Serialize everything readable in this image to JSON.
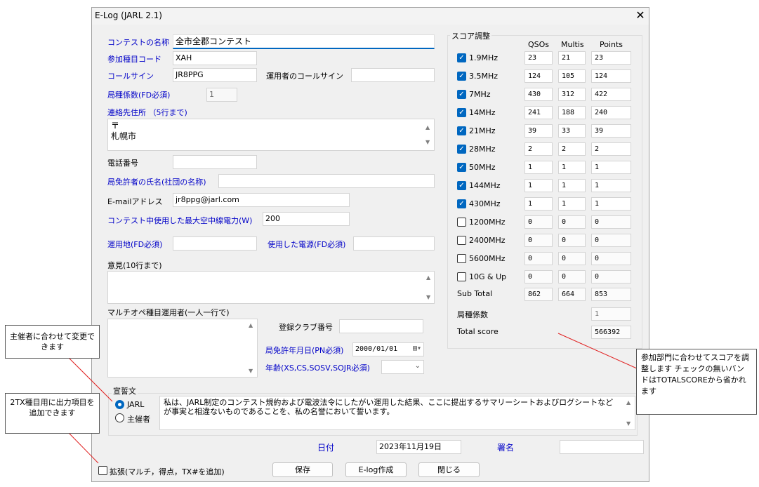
{
  "window": {
    "title": "E-Log (JARL 2.1)",
    "close_icon": "✕"
  },
  "form": {
    "contest_name_label": "コンテストの名称",
    "contest_name_value": "全市全郡コンテスト",
    "category_code_label": "参加種目コード",
    "category_code_value": "XAH",
    "callsign_label": "コールサイン",
    "callsign_value": "JR8PPG",
    "operator_callsign_label": "運用者のコールサイン",
    "operator_callsign_value": "",
    "station_factor_label": "局種係数(FD必須)",
    "station_factor_value": "1",
    "address_label": "連絡先住所 （5行まで)",
    "address_line1": "〒",
    "address_line2": "札幌市",
    "phone_label": "電話番号",
    "phone_value": "",
    "licensee_label": "局免許者の氏名(社団の名称)",
    "licensee_value": "",
    "email_label": "E-mailアドレス",
    "email_value": "jr8ppg@jarl.com",
    "power_label": "コンテスト中使用した最大空中線電力(W)",
    "power_value": "200",
    "location_label": "運用地(FD必須)",
    "location_value": "",
    "power_source_label": "使用した電源(FD必須)",
    "power_source_value": "",
    "comments_label": "意見(10行まで)",
    "comments_value": "",
    "multiop_label": "マルチオペ種目運用者(一人一行で)",
    "multiop_value": "",
    "club_no_label": "登録クラブ番号",
    "club_no_value": "",
    "license_date_label": "局免許年月日(PN必須)",
    "license_date_value": "2000/01/01",
    "age_label": "年齢(XS,CS,SOSV,SOJR必須)",
    "age_value": ""
  },
  "oath": {
    "group_title": "宣誓文",
    "radio_jarl": "JARL",
    "radio_organizer": "主催者",
    "selected": "JARL",
    "text": "私は、JARL制定のコンテスト規約および電波法令にしたがい運用した結果、ここに提出するサマリーシートおよびログシートなどが事実と相違ないものであることを、私の名誉において誓います。"
  },
  "footer": {
    "date_label": "日付",
    "date_value": "2023年11月19日",
    "signature_label": "署名",
    "signature_value": "",
    "extend_label": "拡張(マルチ，得点，TX#を追加)",
    "save_button": "保存",
    "elog_button": "E-log作成",
    "close_button": "閉じる"
  },
  "score": {
    "group_title": "スコア調整",
    "col_qsos": "QSOs",
    "col_multis": "Multis",
    "col_points": "Points",
    "bands": [
      {
        "name": "1.9MHz",
        "checked": true,
        "qsos": "23",
        "multis": "21",
        "points": "23"
      },
      {
        "name": "3.5MHz",
        "checked": true,
        "qsos": "124",
        "multis": "105",
        "points": "124"
      },
      {
        "name": "7MHz",
        "checked": true,
        "qsos": "430",
        "multis": "312",
        "points": "422"
      },
      {
        "name": "14MHz",
        "checked": true,
        "qsos": "241",
        "multis": "188",
        "points": "240"
      },
      {
        "name": "21MHz",
        "checked": true,
        "qsos": "39",
        "multis": "33",
        "points": "39"
      },
      {
        "name": "28MHz",
        "checked": true,
        "qsos": "2",
        "multis": "2",
        "points": "2"
      },
      {
        "name": "50MHz",
        "checked": true,
        "qsos": "1",
        "multis": "1",
        "points": "1"
      },
      {
        "name": "144MHz",
        "checked": true,
        "qsos": "1",
        "multis": "1",
        "points": "1"
      },
      {
        "name": "430MHz",
        "checked": true,
        "qsos": "1",
        "multis": "1",
        "points": "1"
      },
      {
        "name": "1200MHz",
        "checked": false,
        "qsos": "0",
        "multis": "0",
        "points": "0"
      },
      {
        "name": "2400MHz",
        "checked": false,
        "qsos": "0",
        "multis": "0",
        "points": "0"
      },
      {
        "name": "5600MHz",
        "checked": false,
        "qsos": "0",
        "multis": "0",
        "points": "0"
      },
      {
        "name": "10G & Up",
        "checked": false,
        "qsos": "0",
        "multis": "0",
        "points": "0"
      }
    ],
    "subtotal_label": "Sub Total",
    "subtotal_qsos": "862",
    "subtotal_multis": "664",
    "subtotal_points": "853",
    "factor_label": "局種係数",
    "factor_value": "1",
    "total_label": "Total score",
    "total_value": "566392"
  },
  "callouts": {
    "organizer": "主催者に合わせて変更できます",
    "extend": "2TX種目用に出力項目を追加できます",
    "score": "参加部門に合わせてスコアを調整します チェックの無いバンドはTOTALSCOREから省かれます"
  },
  "colors": {
    "label_blue": "#0000c8",
    "accent": "#0067c0"
  }
}
